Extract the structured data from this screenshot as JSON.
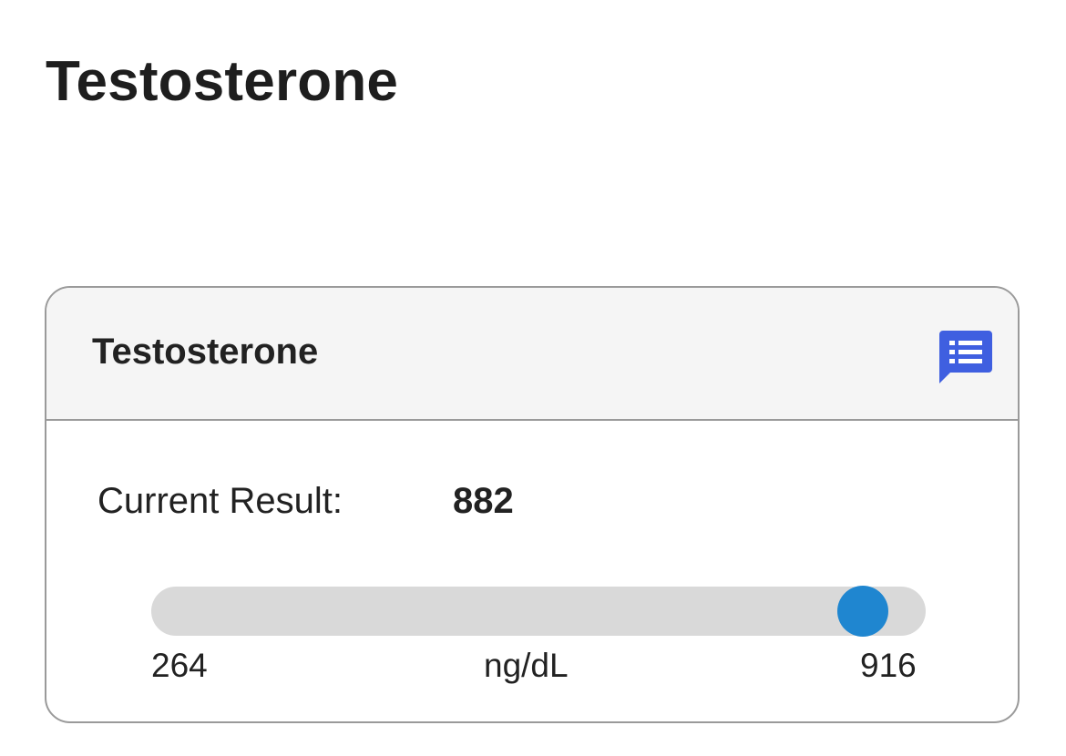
{
  "page": {
    "title": "Testosterone"
  },
  "card": {
    "title": "Testosterone",
    "notes_icon": "list-comment-icon",
    "result_label": "Current Result:",
    "result_value": "882",
    "range": {
      "min": "264",
      "max": "916",
      "unit": "ng/dL",
      "current": 882
    }
  },
  "colors": {
    "accent": "#1f86d0",
    "icon": "#3f5fe0",
    "track": "#d9d9d9",
    "header_bg": "#f5f5f5",
    "border": "#9a9a9a"
  }
}
